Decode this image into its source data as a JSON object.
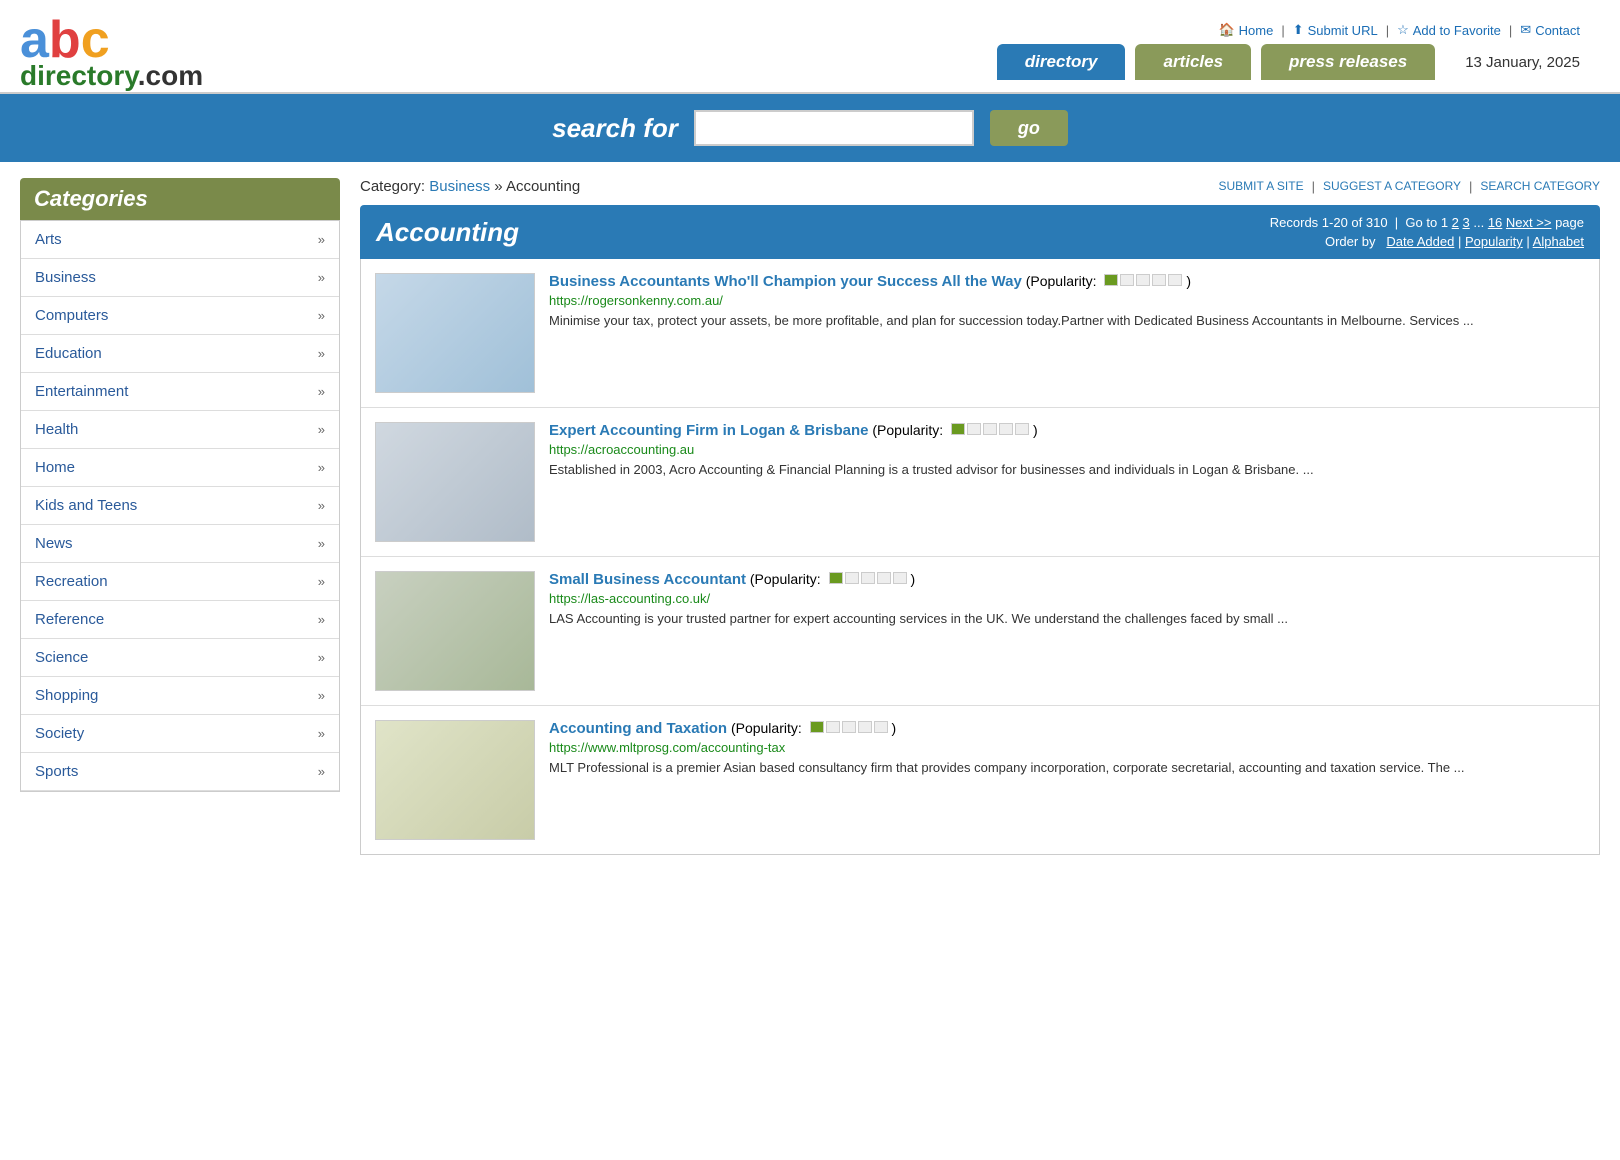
{
  "logo": {
    "abc_a": "a",
    "abc_b": "b",
    "abc_c": "c",
    "directory": "directory",
    "dot": ".",
    "com": "com"
  },
  "toplinks": {
    "home": "Home",
    "submit_url": "Submit URL",
    "add_favorite": "Add to Favorite",
    "contact": "Contact"
  },
  "tabs": {
    "directory": "directory",
    "articles": "articles",
    "press_releases": "press releases"
  },
  "date": "13 January, 2025",
  "search": {
    "label": "search for",
    "placeholder": "",
    "button": "go"
  },
  "sidebar": {
    "title": "Categories",
    "items": [
      {
        "name": "Arts",
        "chevron": "»"
      },
      {
        "name": "Business",
        "chevron": "»"
      },
      {
        "name": "Computers",
        "chevron": "»"
      },
      {
        "name": "Education",
        "chevron": "»"
      },
      {
        "name": "Entertainment",
        "chevron": "»"
      },
      {
        "name": "Health",
        "chevron": "»"
      },
      {
        "name": "Home",
        "chevron": "»"
      },
      {
        "name": "Kids and Teens",
        "chevron": "»"
      },
      {
        "name": "News",
        "chevron": "»"
      },
      {
        "name": "Recreation",
        "chevron": "»"
      },
      {
        "name": "Reference",
        "chevron": "»"
      },
      {
        "name": "Science",
        "chevron": "»"
      },
      {
        "name": "Shopping",
        "chevron": "»"
      },
      {
        "name": "Society",
        "chevron": "»"
      },
      {
        "name": "Sports",
        "chevron": "»"
      }
    ]
  },
  "breadcrumb": {
    "category_label": "Category:",
    "parent": "Business",
    "separator": "»",
    "current": "Accounting",
    "submit_site": "SUBMIT A SITE",
    "suggest_category": "SUGGEST A CATEGORY",
    "search_category": "SEARCH CATEGORY"
  },
  "category": {
    "title": "Accounting",
    "records_text": "Records 1-20 of 310",
    "separator": "|",
    "goto_text": "Go to 1",
    "pages": [
      "2",
      "3",
      "...",
      "16"
    ],
    "next": "Next >>",
    "page_label": "page",
    "order_label": "Order by",
    "date_added": "Date Added",
    "popularity": "Popularity",
    "alphabet": "Alphabet"
  },
  "listings": [
    {
      "title": "Business Accountants Who'll Champion your Success All the Way",
      "popularity_filled": 1,
      "popularity_total": 5,
      "url": "https://rogersonkenny.com.au/",
      "description": "Minimise your tax, protect your assets, be more profitable, and plan for succession today.Partner with Dedicated Business Accountants in Melbourne. Services ..."
    },
    {
      "title": "Expert Accounting Firm in Logan & Brisbane",
      "popularity_filled": 1,
      "popularity_total": 5,
      "url": "https://acroaccounting.au",
      "description": "Established in 2003, Acro Accounting & Financial Planning is a trusted advisor for businesses and individuals in Logan & Brisbane. ..."
    },
    {
      "title": "Small Business Accountant",
      "popularity_filled": 1,
      "popularity_total": 5,
      "url": "https://las-accounting.co.uk/",
      "description": "LAS Accounting is your trusted partner for expert accounting services in the UK. We understand the challenges faced by small ..."
    },
    {
      "title": "Accounting and Taxation",
      "popularity_filled": 1,
      "popularity_total": 5,
      "url": "https://www.mltprosg.com/accounting-tax",
      "description": "MLT Professional is a premier Asian based consultancy firm that provides company incorporation, corporate secretarial, accounting and taxation service. The ..."
    }
  ]
}
